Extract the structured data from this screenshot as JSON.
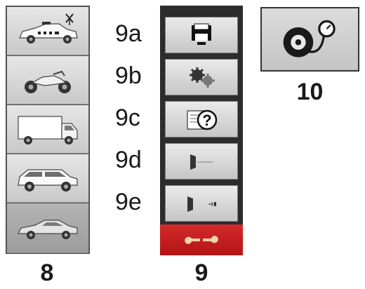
{
  "groups": {
    "vehicles": {
      "number": "8",
      "selected": "car"
    },
    "menu": {
      "number": "9"
    },
    "tire_pressure": {
      "number": "10"
    }
  },
  "vehicles": [
    {
      "name": "police-car",
      "icon": "police-car-icon"
    },
    {
      "name": "motorcycle",
      "icon": "motorcycle-icon"
    },
    {
      "name": "truck",
      "icon": "truck-icon"
    },
    {
      "name": "suv",
      "icon": "suv-icon"
    },
    {
      "name": "car",
      "icon": "car-icon"
    }
  ],
  "menu_items": [
    {
      "label": "9a",
      "icon": "printer-icon"
    },
    {
      "label": "9b",
      "icon": "gears-icon"
    },
    {
      "label": "9c",
      "icon": "help-icon"
    },
    {
      "label": "9d",
      "icon": "exit-icon"
    },
    {
      "label": "9e",
      "icon": "exit-right-icon"
    }
  ],
  "tool_button": {
    "icon": "wrench-icon"
  },
  "tire_button": {
    "icon": "tire-gauge-icon"
  },
  "colors": {
    "tool_button_red": "#c41e1e",
    "menu_background": "#2c2c2c"
  }
}
